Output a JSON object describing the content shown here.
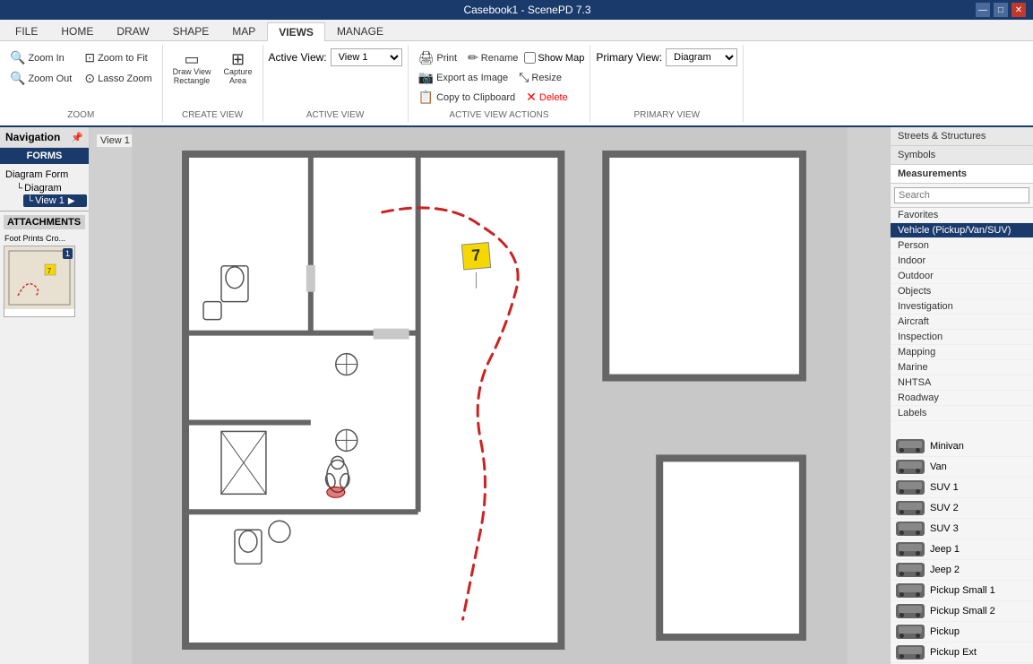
{
  "titleBar": {
    "title": "Casebook1 - ScenePD 7.3",
    "minimizeBtn": "—",
    "maximizeBtn": "□",
    "closeBtn": "✕"
  },
  "ribbonTabs": [
    {
      "label": "FILE",
      "active": false
    },
    {
      "label": "HOME",
      "active": false
    },
    {
      "label": "DRAW",
      "active": false
    },
    {
      "label": "SHAPE",
      "active": false
    },
    {
      "label": "MAP",
      "active": false
    },
    {
      "label": "VIEWS",
      "active": true
    },
    {
      "label": "MANAGE",
      "active": false
    }
  ],
  "ribbon": {
    "sections": [
      {
        "name": "zoom",
        "label": "ZOOM",
        "buttons": [
          {
            "id": "zoom-in",
            "icon": "🔍",
            "label": "Zoom In"
          },
          {
            "id": "zoom-out",
            "icon": "🔍",
            "label": "Zoom Out"
          },
          {
            "id": "zoom-fit",
            "icon": "⊡",
            "label": "Zoom to Fit"
          },
          {
            "id": "lasso-zoom",
            "icon": "⊙",
            "label": "Lasso Zoom"
          }
        ]
      },
      {
        "name": "create-view",
        "label": "CREATE VIEW",
        "buttons": [
          {
            "id": "draw-view",
            "icon": "▭",
            "label": "Draw View Rectangle"
          },
          {
            "id": "capture-area",
            "icon": "⊞",
            "label": "Capture Area"
          }
        ]
      },
      {
        "name": "active-view",
        "label": "ACTIVE VIEW",
        "activeViewLabel": "Active View:",
        "activeViewValue": "View 1"
      },
      {
        "name": "active-view-actions",
        "label": "ACTIVE VIEW ACTIONS",
        "buttons": [
          {
            "id": "print",
            "icon": "🖨",
            "label": "Print"
          },
          {
            "id": "rename",
            "icon": "✏",
            "label": "Rename"
          },
          {
            "id": "show-map",
            "label": "Show Map"
          },
          {
            "id": "export-image",
            "icon": "📷",
            "label": "Export as Image"
          },
          {
            "id": "resize",
            "icon": "⤡",
            "label": "Resize"
          },
          {
            "id": "copy-clipboard",
            "icon": "📋",
            "label": "Copy to Clipboard"
          },
          {
            "id": "delete",
            "icon": "✕",
            "label": "Delete"
          }
        ]
      },
      {
        "name": "primary-view",
        "label": "PRIMARY VIEW",
        "primaryViewLabel": "Primary View:",
        "primaryViewValue": "Diagram"
      }
    ]
  },
  "navigation": {
    "header": "Navigation",
    "pinIcon": "📌",
    "formsLabel": "FORMS",
    "treeItems": [
      {
        "id": "diagram-form",
        "label": "Diagram Form",
        "children": [
          {
            "id": "diagram",
            "label": "Diagram",
            "children": [
              {
                "id": "view1",
                "label": "View 1",
                "selected": true
              }
            ]
          }
        ]
      }
    ]
  },
  "attachments": {
    "header": "ATTACHMENTS",
    "items": [
      {
        "id": "foot-prints",
        "label": "Foot Prints Cro...",
        "badge": "1"
      }
    ]
  },
  "canvas": {
    "viewLabel": "View 1"
  },
  "rightPanel": {
    "tabs": [
      {
        "id": "streets-structures",
        "label": "Streets & Structures",
        "active": false
      },
      {
        "id": "symbols",
        "label": "Symbols",
        "active": false
      },
      {
        "id": "measurements",
        "label": "Measurements",
        "active": true
      }
    ],
    "searchPlaceholder": "Search",
    "favorites": "Favorites",
    "categories": [
      {
        "id": "vehicle",
        "label": "Vehicle (Pickup/Van/SUV)",
        "selected": true
      },
      {
        "id": "person",
        "label": "Person"
      },
      {
        "id": "indoor",
        "label": "Indoor"
      },
      {
        "id": "outdoor",
        "label": "Outdoor"
      },
      {
        "id": "objects",
        "label": "Objects"
      },
      {
        "id": "investigation",
        "label": "Investigation"
      },
      {
        "id": "aircraft",
        "label": "Aircraft"
      },
      {
        "id": "inspection",
        "label": "Inspection"
      },
      {
        "id": "mapping",
        "label": "Mapping"
      },
      {
        "id": "marine",
        "label": "Marine"
      },
      {
        "id": "nhtsa",
        "label": "NHTSA"
      },
      {
        "id": "roadway",
        "label": "Roadway"
      },
      {
        "id": "labels",
        "label": "Labels"
      }
    ],
    "vehicles": [
      {
        "id": "minivan",
        "label": "Minivan"
      },
      {
        "id": "van",
        "label": "Van"
      },
      {
        "id": "suv1",
        "label": "SUV 1"
      },
      {
        "id": "suv2",
        "label": "SUV 2"
      },
      {
        "id": "suv3",
        "label": "SUV 3"
      },
      {
        "id": "jeep1",
        "label": "Jeep 1"
      },
      {
        "id": "jeep2",
        "label": "Jeep 2"
      },
      {
        "id": "pickup-small1",
        "label": "Pickup Small 1"
      },
      {
        "id": "pickup-small2",
        "label": "Pickup Small 2"
      },
      {
        "id": "pickup",
        "label": "Pickup"
      },
      {
        "id": "pickup-ext",
        "label": "Pickup Ext"
      }
    ]
  }
}
